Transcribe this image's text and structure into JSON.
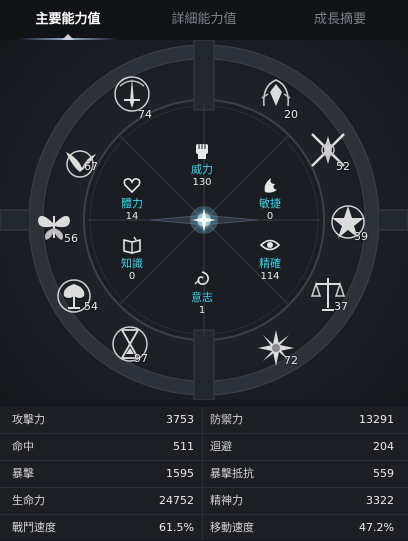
{
  "tabs": [
    {
      "label": "主要能力值",
      "active": true
    },
    {
      "label": "詳細能力值",
      "active": false
    },
    {
      "label": "成長摘要",
      "active": false
    }
  ],
  "outer_stats": [
    {
      "id": "sword",
      "value": "74"
    },
    {
      "id": "helm",
      "value": "20"
    },
    {
      "id": "bird",
      "value": "67"
    },
    {
      "id": "cross",
      "value": "52"
    },
    {
      "id": "butterfly",
      "value": "56"
    },
    {
      "id": "star",
      "value": "39"
    },
    {
      "id": "tree",
      "value": "54"
    },
    {
      "id": "scale",
      "value": "37"
    },
    {
      "id": "hourglass",
      "value": "97"
    },
    {
      "id": "flower",
      "value": "72"
    }
  ],
  "inner_stats": [
    {
      "id": "power",
      "label": "威力",
      "value": "130",
      "icon": "fist-icon"
    },
    {
      "id": "vitality",
      "label": "體力",
      "value": "14",
      "icon": "heart-icon"
    },
    {
      "id": "agility",
      "label": "敏捷",
      "value": "0",
      "icon": "flame-icon"
    },
    {
      "id": "knowledge",
      "label": "知識",
      "value": "0",
      "icon": "book-icon"
    },
    {
      "id": "precision",
      "label": "精確",
      "value": "114",
      "icon": "eye-icon"
    },
    {
      "id": "will",
      "label": "意志",
      "value": "1",
      "icon": "swirl-icon"
    }
  ],
  "stats_table": {
    "left": [
      {
        "label": "攻擊力",
        "value": "3753"
      },
      {
        "label": "命中",
        "value": "511"
      },
      {
        "label": "暴擊",
        "value": "1595"
      },
      {
        "label": "生命力",
        "value": "24752"
      },
      {
        "label": "戰鬥速度",
        "value": "61.5%"
      }
    ],
    "right": [
      {
        "label": "防禦力",
        "value": "13291"
      },
      {
        "label": "迴避",
        "value": "204"
      },
      {
        "label": "暴擊抵抗",
        "value": "559"
      },
      {
        "label": "精神力",
        "value": "3322"
      },
      {
        "label": "移動速度",
        "value": "47.2%"
      }
    ]
  },
  "colors": {
    "accent_cyan": "#3fd1e6",
    "background": "#15171c",
    "ring": "#3a3f48"
  }
}
